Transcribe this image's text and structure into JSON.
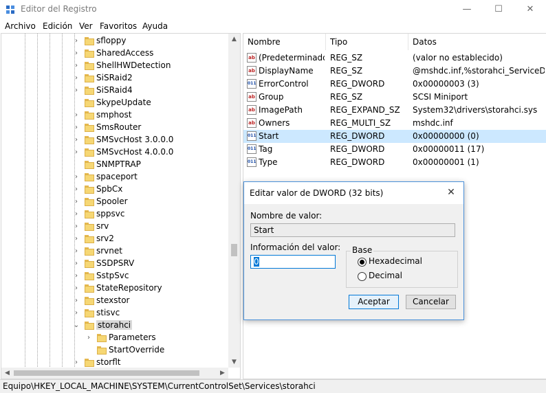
{
  "window": {
    "title": "Editor del Registro",
    "minimize": "—",
    "maximize": "☐",
    "close": "✕"
  },
  "menu": [
    "Archivo",
    "Edición",
    "Ver",
    "Favoritos",
    "Ayuda"
  ],
  "tree": {
    "items": [
      {
        "label": "sfloppy",
        "expander": "›"
      },
      {
        "label": "SharedAccess",
        "expander": "›"
      },
      {
        "label": "ShellHWDetection",
        "expander": "›"
      },
      {
        "label": "SiSRaid2",
        "expander": "›"
      },
      {
        "label": "SiSRaid4",
        "expander": "›"
      },
      {
        "label": "SkypeUpdate",
        "expander": ""
      },
      {
        "label": "smphost",
        "expander": "›"
      },
      {
        "label": "SmsRouter",
        "expander": "›"
      },
      {
        "label": "SMSvcHost 3.0.0.0",
        "expander": "›"
      },
      {
        "label": "SMSvcHost 4.0.0.0",
        "expander": "›"
      },
      {
        "label": "SNMPTRAP",
        "expander": ""
      },
      {
        "label": "spaceport",
        "expander": "›"
      },
      {
        "label": "SpbCx",
        "expander": "›"
      },
      {
        "label": "Spooler",
        "expander": "›"
      },
      {
        "label": "sppsvc",
        "expander": "›"
      },
      {
        "label": "srv",
        "expander": "›"
      },
      {
        "label": "srv2",
        "expander": "›"
      },
      {
        "label": "srvnet",
        "expander": "›"
      },
      {
        "label": "SSDPSRV",
        "expander": "›"
      },
      {
        "label": "SstpSvc",
        "expander": "›"
      },
      {
        "label": "StateRepository",
        "expander": "›"
      },
      {
        "label": "stexstor",
        "expander": "›"
      },
      {
        "label": "stisvc",
        "expander": "›"
      },
      {
        "label": "storahci",
        "expander": "⌄",
        "selected": true
      },
      {
        "label": "Parameters",
        "expander": "›",
        "child": true
      },
      {
        "label": "StartOverride",
        "expander": "",
        "child": true
      },
      {
        "label": "storflt",
        "expander": "›"
      }
    ]
  },
  "list": {
    "columns": [
      "Nombre",
      "Tipo",
      "Datos"
    ],
    "rows": [
      {
        "icon": "string",
        "name": "(Predeterminado)",
        "type": "REG_SZ",
        "data": "(valor no establecido)"
      },
      {
        "icon": "string",
        "name": "DisplayName",
        "type": "REG_SZ",
        "data": "@mshdc.inf,%storahci_ServiceDescr"
      },
      {
        "icon": "binary",
        "name": "ErrorControl",
        "type": "REG_DWORD",
        "data": "0x00000003 (3)"
      },
      {
        "icon": "string",
        "name": "Group",
        "type": "REG_SZ",
        "data": "SCSI Miniport"
      },
      {
        "icon": "string",
        "name": "ImagePath",
        "type": "REG_EXPAND_SZ",
        "data": "System32\\drivers\\storahci.sys"
      },
      {
        "icon": "string",
        "name": "Owners",
        "type": "REG_MULTI_SZ",
        "data": "mshdc.inf"
      },
      {
        "icon": "binary",
        "name": "Start",
        "type": "REG_DWORD",
        "data": "0x00000000 (0)",
        "selected": true
      },
      {
        "icon": "binary",
        "name": "Tag",
        "type": "REG_DWORD",
        "data": "0x00000011 (17)"
      },
      {
        "icon": "binary",
        "name": "Type",
        "type": "REG_DWORD",
        "data": "0x00000001 (1)"
      }
    ]
  },
  "status": "Equipo\\HKEY_LOCAL_MACHINE\\SYSTEM\\CurrentControlSet\\Services\\storahci",
  "dialog": {
    "title": "Editar valor de DWORD (32 bits)",
    "close": "✕",
    "name_label": "Nombre de valor:",
    "name_value": "Start",
    "data_label": "Información del valor:",
    "data_value": "0",
    "base_label": "Base",
    "base_options": [
      "Hexadecimal",
      "Decimal"
    ],
    "base_selected": "Hexadecimal",
    "ok": "Aceptar",
    "cancel": "Cancelar"
  },
  "icons": {
    "string_icon_text": "ab",
    "binary_icon_text": "011"
  }
}
